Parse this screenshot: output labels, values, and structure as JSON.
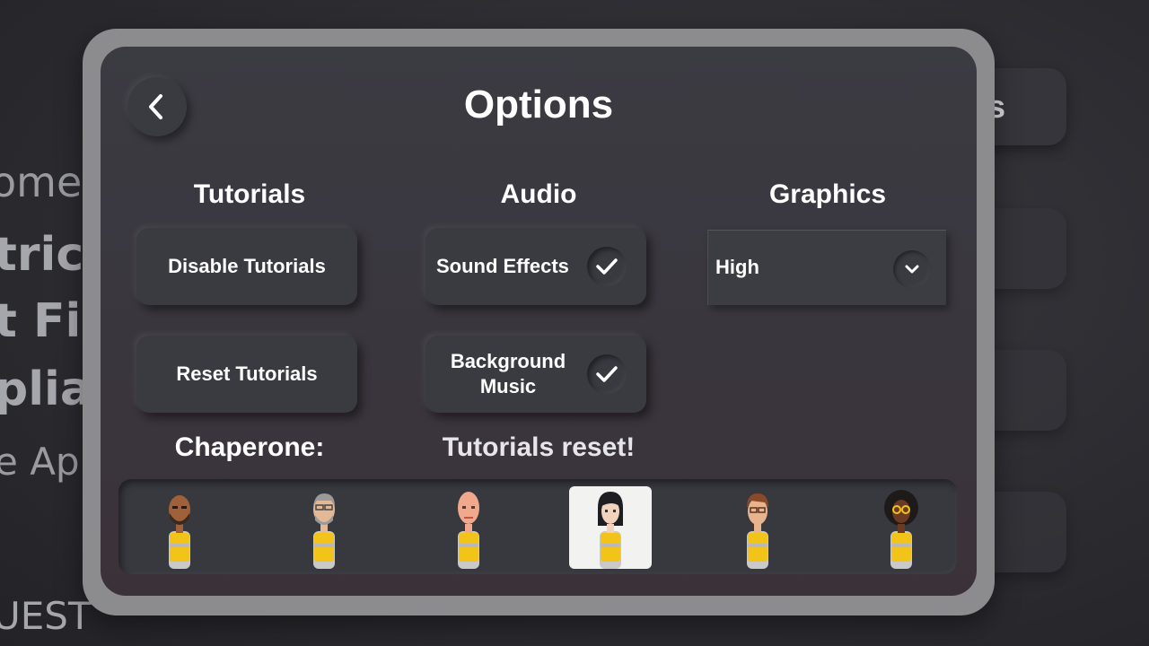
{
  "background": {
    "welcome_fragment": "ome t",
    "line1_fragment": "trica",
    "line2_fragment": "t Fir",
    "line3_fragment": "plia",
    "sub_fragment": "e App",
    "quest_fragment": "UEST",
    "right_button_fragment": "s"
  },
  "dialog": {
    "title": "Options",
    "back_icon": "chevron-left-icon",
    "sections": {
      "tutorials": {
        "heading": "Tutorials",
        "disable_label": "Disable Tutorials",
        "reset_label": "Reset Tutorials"
      },
      "audio": {
        "heading": "Audio",
        "sound_effects_label": "Sound Effects",
        "sound_effects_checked": true,
        "background_music_label": "Background Music",
        "background_music_checked": true
      },
      "graphics": {
        "heading": "Graphics",
        "selected_option": "High",
        "dropdown_icon": "chevron-down-icon"
      }
    },
    "chaperone": {
      "label": "Chaperone:",
      "status_message": "Tutorials reset!",
      "avatars": [
        {
          "name": "chaperone-avatar-1",
          "skin": "#a0603a",
          "hair": "#3a2a20",
          "selected": false
        },
        {
          "name": "chaperone-avatar-2",
          "skin": "#e2b896",
          "hair": "#9a9a9a",
          "selected": false
        },
        {
          "name": "chaperone-avatar-3",
          "skin": "#f0a98c",
          "hair": "#f0a98c",
          "selected": false
        },
        {
          "name": "chaperone-avatar-4",
          "skin": "#f3d2bd",
          "hair": "#1e1e22",
          "selected": true
        },
        {
          "name": "chaperone-avatar-5",
          "skin": "#e8b48e",
          "hair": "#8a4a2a",
          "selected": false
        },
        {
          "name": "chaperone-avatar-6",
          "skin": "#6b3a22",
          "hair": "#1e1a1a",
          "selected": false
        }
      ]
    },
    "colors": {
      "vest": "#f2c318",
      "vest_stripe": "#b9b9b9"
    }
  }
}
